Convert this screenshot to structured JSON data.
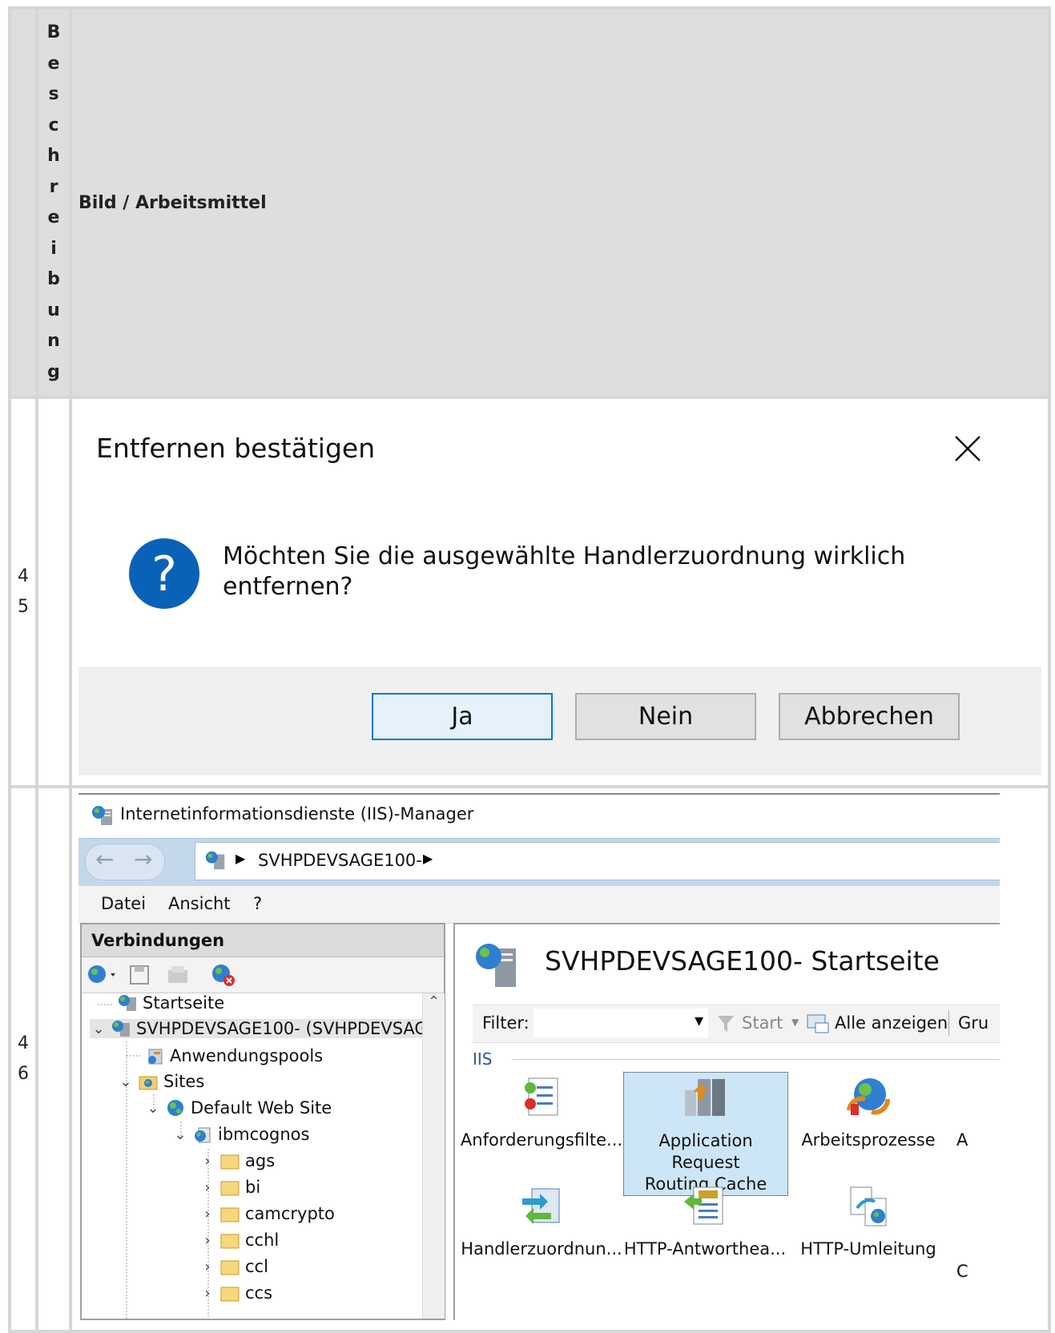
{
  "table": {
    "header": {
      "col1": "",
      "col2": "Beschreibung",
      "col3": "Bild / Arbeitsmittel"
    },
    "rows": [
      {
        "number": "45"
      },
      {
        "number": "46"
      }
    ]
  },
  "dialog": {
    "title": "Entfernen bestätigen",
    "message": "Möchten Sie die ausgewählte Handlerzuordnung wirklich entfernen?",
    "buttons": {
      "yes": "Ja",
      "no": "Nein",
      "cancel": "Abbrechen"
    },
    "colors": {
      "question_icon": "#0a62b8",
      "default_button_border": "#0078d7"
    }
  },
  "iis": {
    "window_title": "Internetinformationsdienste (IIS)-Manager",
    "address": "SVHPDEVSAGE100-",
    "menu": {
      "file": "Datei",
      "view": "Ansicht",
      "help": "?"
    },
    "connections": {
      "title": "Verbindungen",
      "tree": {
        "start": "Startseite",
        "server": "SVHPDEVSAGE100- (SVHPDEVSAGE1",
        "app_pools": "Anwendungspools",
        "sites": "Sites",
        "default_site": "Default Web Site",
        "app": "ibmcognos",
        "folders": [
          "ags",
          "bi",
          "camcrypto",
          "cchl",
          "ccl",
          "ccs"
        ]
      }
    },
    "home": {
      "title": "SVHPDEVSAGE100- Startseite",
      "filter_label": "Filter:",
      "start": "Start",
      "show_all": "Alle anzeigen",
      "group": "Gru",
      "group_header": "IIS",
      "features": {
        "request_filter": "Anforderungsfilte...",
        "arr_cache_1": "Application Request",
        "arr_cache_2": "Routing Cache",
        "worker_processes": "Arbeitsprozesse",
        "truncated_a": "A",
        "handler_mappings": "Handlerzuordnun...",
        "response_headers": "HTTP-Antworthea...",
        "redirect": "HTTP-Umleitung",
        "truncated_c": "C"
      }
    }
  }
}
